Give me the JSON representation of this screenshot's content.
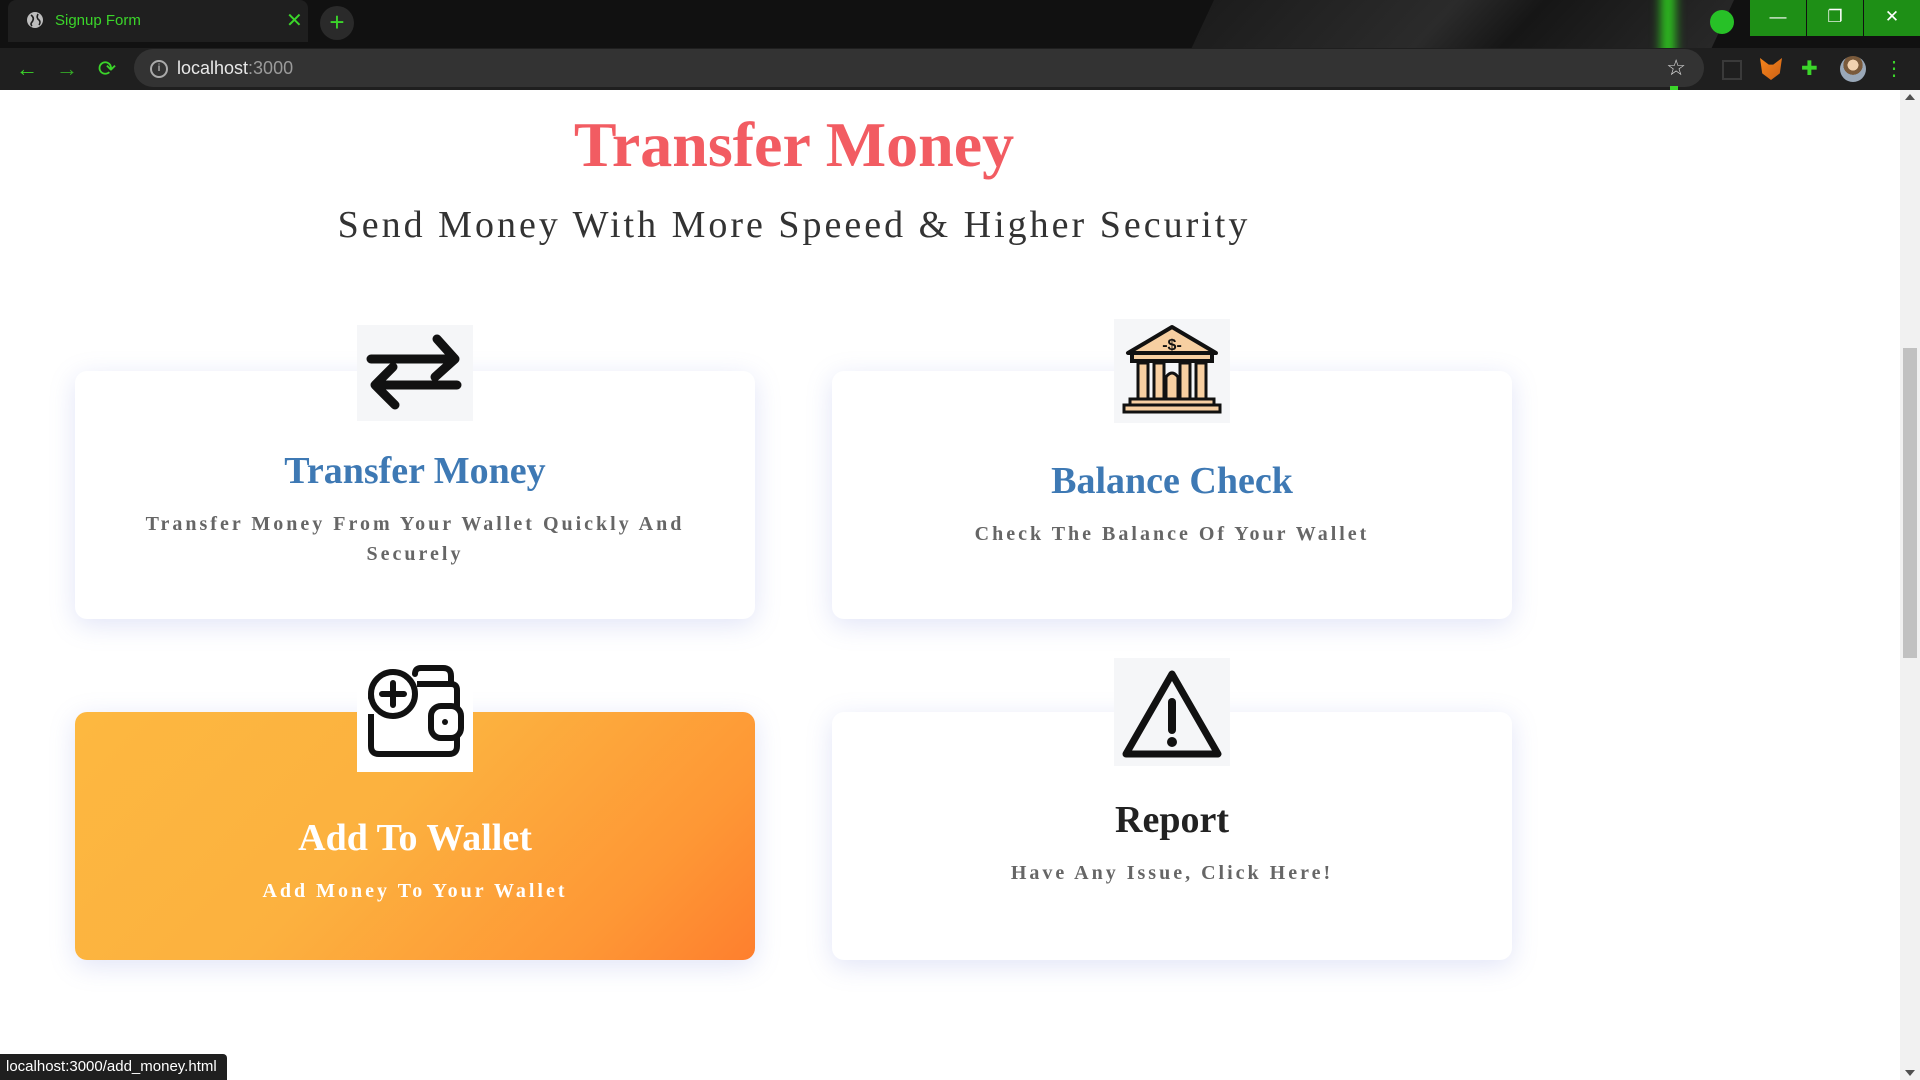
{
  "browser": {
    "tab_title": "Signup Form",
    "tab_close": "✕",
    "new_tab": "+",
    "url_host": "localhost",
    "url_port": ":3000",
    "window_buttons": {
      "minimize": "—",
      "maximize": "❐",
      "close": "✕"
    },
    "nav": {
      "back": "←",
      "forward": "→",
      "reload": "⟳"
    },
    "star": "☆",
    "accent_color": "#3bd52a"
  },
  "page": {
    "title": "Transfer Money",
    "subtitle": "Send Money With More Speeed & Higher Security",
    "title_color": "#f25c62",
    "link_color": "#3e79b4"
  },
  "cards": [
    {
      "icon": "arrows-exchange-icon",
      "title": "Transfer Money",
      "desc": "Transfer Money From Your Wallet Quickly And Securely"
    },
    {
      "icon": "bank-icon",
      "title": "Balance Check",
      "desc": "Check The Balance Of Your Wallet"
    },
    {
      "icon": "wallet-add-icon",
      "title": "Add To Wallet",
      "desc": "Add Money To Your Wallet",
      "highlight_gradient": [
        "#fdb840",
        "#fe7f2e"
      ]
    },
    {
      "icon": "warning-icon",
      "title": "Report",
      "desc": "Have Any Issue, Click Here!"
    }
  ],
  "status_url": "localhost:3000/add_money.html"
}
